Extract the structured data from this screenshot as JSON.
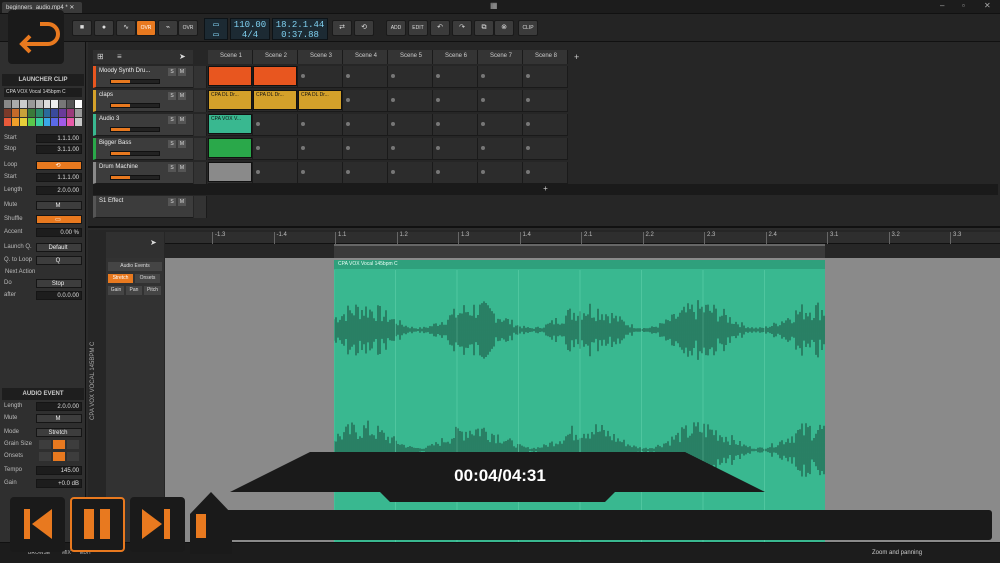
{
  "window": {
    "tab_title": "beginners_audio.mp4 *"
  },
  "toolbar": {
    "ovr1": "OVR",
    "ovr2": "OVR",
    "tempo": "110.00",
    "meter": "4/4",
    "position": "18.2.1.44",
    "time": "0:37.88",
    "add": "ADD",
    "edit": "EDIT",
    "clip": "CLIP"
  },
  "launcher_clip": {
    "header": "LAUNCHER CLIP",
    "clip_name": "CPA VOX Vocal 145bpm C",
    "rows": [
      {
        "label": "Start",
        "value": "1.1.1.00"
      },
      {
        "label": "Stop",
        "value": "3.1.1.00"
      },
      {
        "label": "Loop",
        "value": "⟲"
      },
      {
        "label": "Start",
        "value": "1.1.1.00"
      },
      {
        "label": "Length",
        "value": "2.0.0.00"
      },
      {
        "label": "Mute",
        "value": "M"
      },
      {
        "label": "Shuffle",
        "value": "▭"
      },
      {
        "label": "Accent",
        "value": "0.00 %"
      },
      {
        "label": "Launch Q.",
        "value": "Default"
      },
      {
        "label": "Q. to Loop",
        "value": "Q"
      }
    ],
    "next_action": "Next Action",
    "do_label": "Do",
    "do_value": "Stop",
    "after_label": "after",
    "after_value": "0.0.0.00"
  },
  "audio_event": {
    "header": "AUDIO EVENT",
    "rows": [
      {
        "label": "Length",
        "value": "2.0.0.00"
      },
      {
        "label": "Mute",
        "value": "M"
      },
      {
        "label": "Mode",
        "value": "Stretch"
      },
      {
        "label": "Grain Size",
        "value": ""
      },
      {
        "label": "Onsets",
        "value": ""
      },
      {
        "label": "Tempo",
        "value": "145.00"
      },
      {
        "label": "Gain",
        "value": "+0.0 dB"
      }
    ]
  },
  "scenes": [
    "Scene 1",
    "Scene 2",
    "Scene 3",
    "Scene 4",
    "Scene 5",
    "Scene 6",
    "Scene 7",
    "Scene 8"
  ],
  "tracks": [
    {
      "name": "Moody Synth Dru...",
      "color": "#e8561f",
      "clips": [
        "",
        ""
      ]
    },
    {
      "name": "claps",
      "color": "#d4a12a",
      "clips": [
        "CPA DL Dr...",
        "CPA DL Dr...",
        "CPA DL Dr..."
      ]
    },
    {
      "name": "Audio 3",
      "color": "#39b890",
      "clips": [
        "CPA VOX V..."
      ]
    },
    {
      "name": "Bigger Bass",
      "color": "#2aa84a",
      "clips": [
        ""
      ]
    },
    {
      "name": "Drum Machine",
      "color": "#8a8a8a",
      "clips": [
        ""
      ]
    },
    {
      "name": "S1 Effect",
      "color": "#555555",
      "clips": []
    }
  ],
  "editor": {
    "ruler": [
      "-1.3",
      "-1.4",
      "1.1",
      "1.2",
      "1.3",
      "1.4",
      "2.1",
      "2.2",
      "2.3",
      "2.4",
      "3.1",
      "3.2",
      "3.3"
    ],
    "audio_events": "Audio Events",
    "stretch": "Stretch",
    "onsets": "Onsets",
    "gain": "Gain",
    "pan": "Pan",
    "pitch": "Pitch",
    "clip_label": "CPA VOX Vocal 145bpm C",
    "vertical_label": "CPA VOX VOCAL 145BPM C"
  },
  "player": {
    "timecode": "00:04/04:31"
  },
  "status": {
    "zoom": "Zoom and panning",
    "left1": "BROWSE",
    "left2": "MIX",
    "left3": "EDIT"
  },
  "colors": {
    "accent": "#e8791f",
    "teal": "#39b890"
  }
}
